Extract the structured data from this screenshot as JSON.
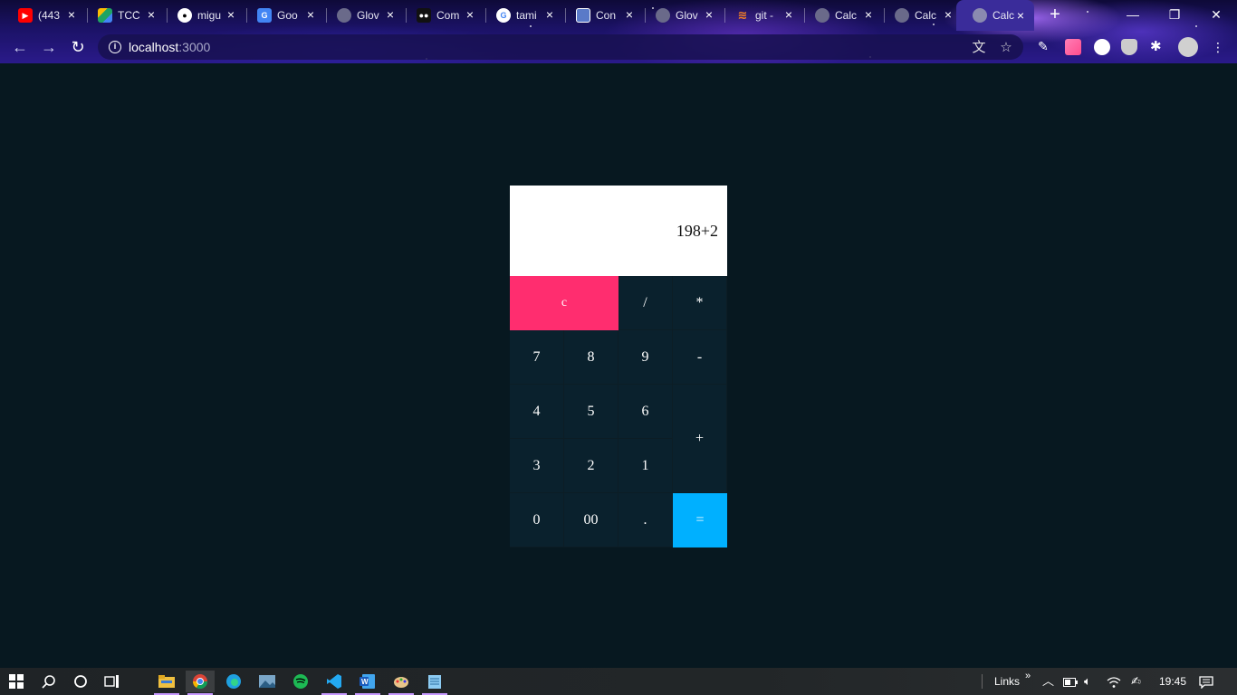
{
  "browser": {
    "tabs": [
      {
        "title": "(443",
        "favicon": "youtube-icon",
        "color": "#ff0000"
      },
      {
        "title": "TCC",
        "favicon": "drive-icon",
        "color": "#1fa463"
      },
      {
        "title": "migu",
        "favicon": "github-icon",
        "color": "#ffffff"
      },
      {
        "title": "Goo",
        "favicon": "google-translate-icon",
        "color": "#4285f4"
      },
      {
        "title": "Glov",
        "favicon": "globe-icon",
        "color": "#6a6a8a"
      },
      {
        "title": "Com",
        "favicon": "medium-icon",
        "color": "#111111"
      },
      {
        "title": "tami",
        "favicon": "google-icon",
        "color": "#ffffff"
      },
      {
        "title": "Con",
        "favicon": "page-icon",
        "color": "#5a7ac8"
      },
      {
        "title": "Glov",
        "favicon": "globe-icon",
        "color": "#6a6a8a"
      },
      {
        "title": "git -",
        "favicon": "stackoverflow-icon",
        "color": "#f48024"
      },
      {
        "title": "Calc",
        "favicon": "globe-icon",
        "color": "#6a6a8a"
      },
      {
        "title": "Calc",
        "favicon": "globe-icon",
        "color": "#6a6a8a"
      },
      {
        "title": "Calc",
        "favicon": "globe-icon",
        "color": "#6a6a8a"
      }
    ],
    "active_tab_index": 12,
    "url_host": "localhost",
    "url_port": ":3000"
  },
  "calculator": {
    "display": "198+2",
    "keys": {
      "clear": "c",
      "divide": "/",
      "multiply": "*",
      "seven": "7",
      "eight": "8",
      "nine": "9",
      "minus": "-",
      "four": "4",
      "five": "5",
      "six": "6",
      "plus": "+",
      "three": "3",
      "two": "2",
      "one": "1",
      "zero": "0",
      "double_zero": "00",
      "decimal": ".",
      "equals": "="
    },
    "colors": {
      "clear": "#ff2d6f",
      "equals": "#00b0ff",
      "key": "#0a212d",
      "background": "#071820"
    }
  },
  "taskbar": {
    "links_label": "Links",
    "time": "19:45"
  }
}
